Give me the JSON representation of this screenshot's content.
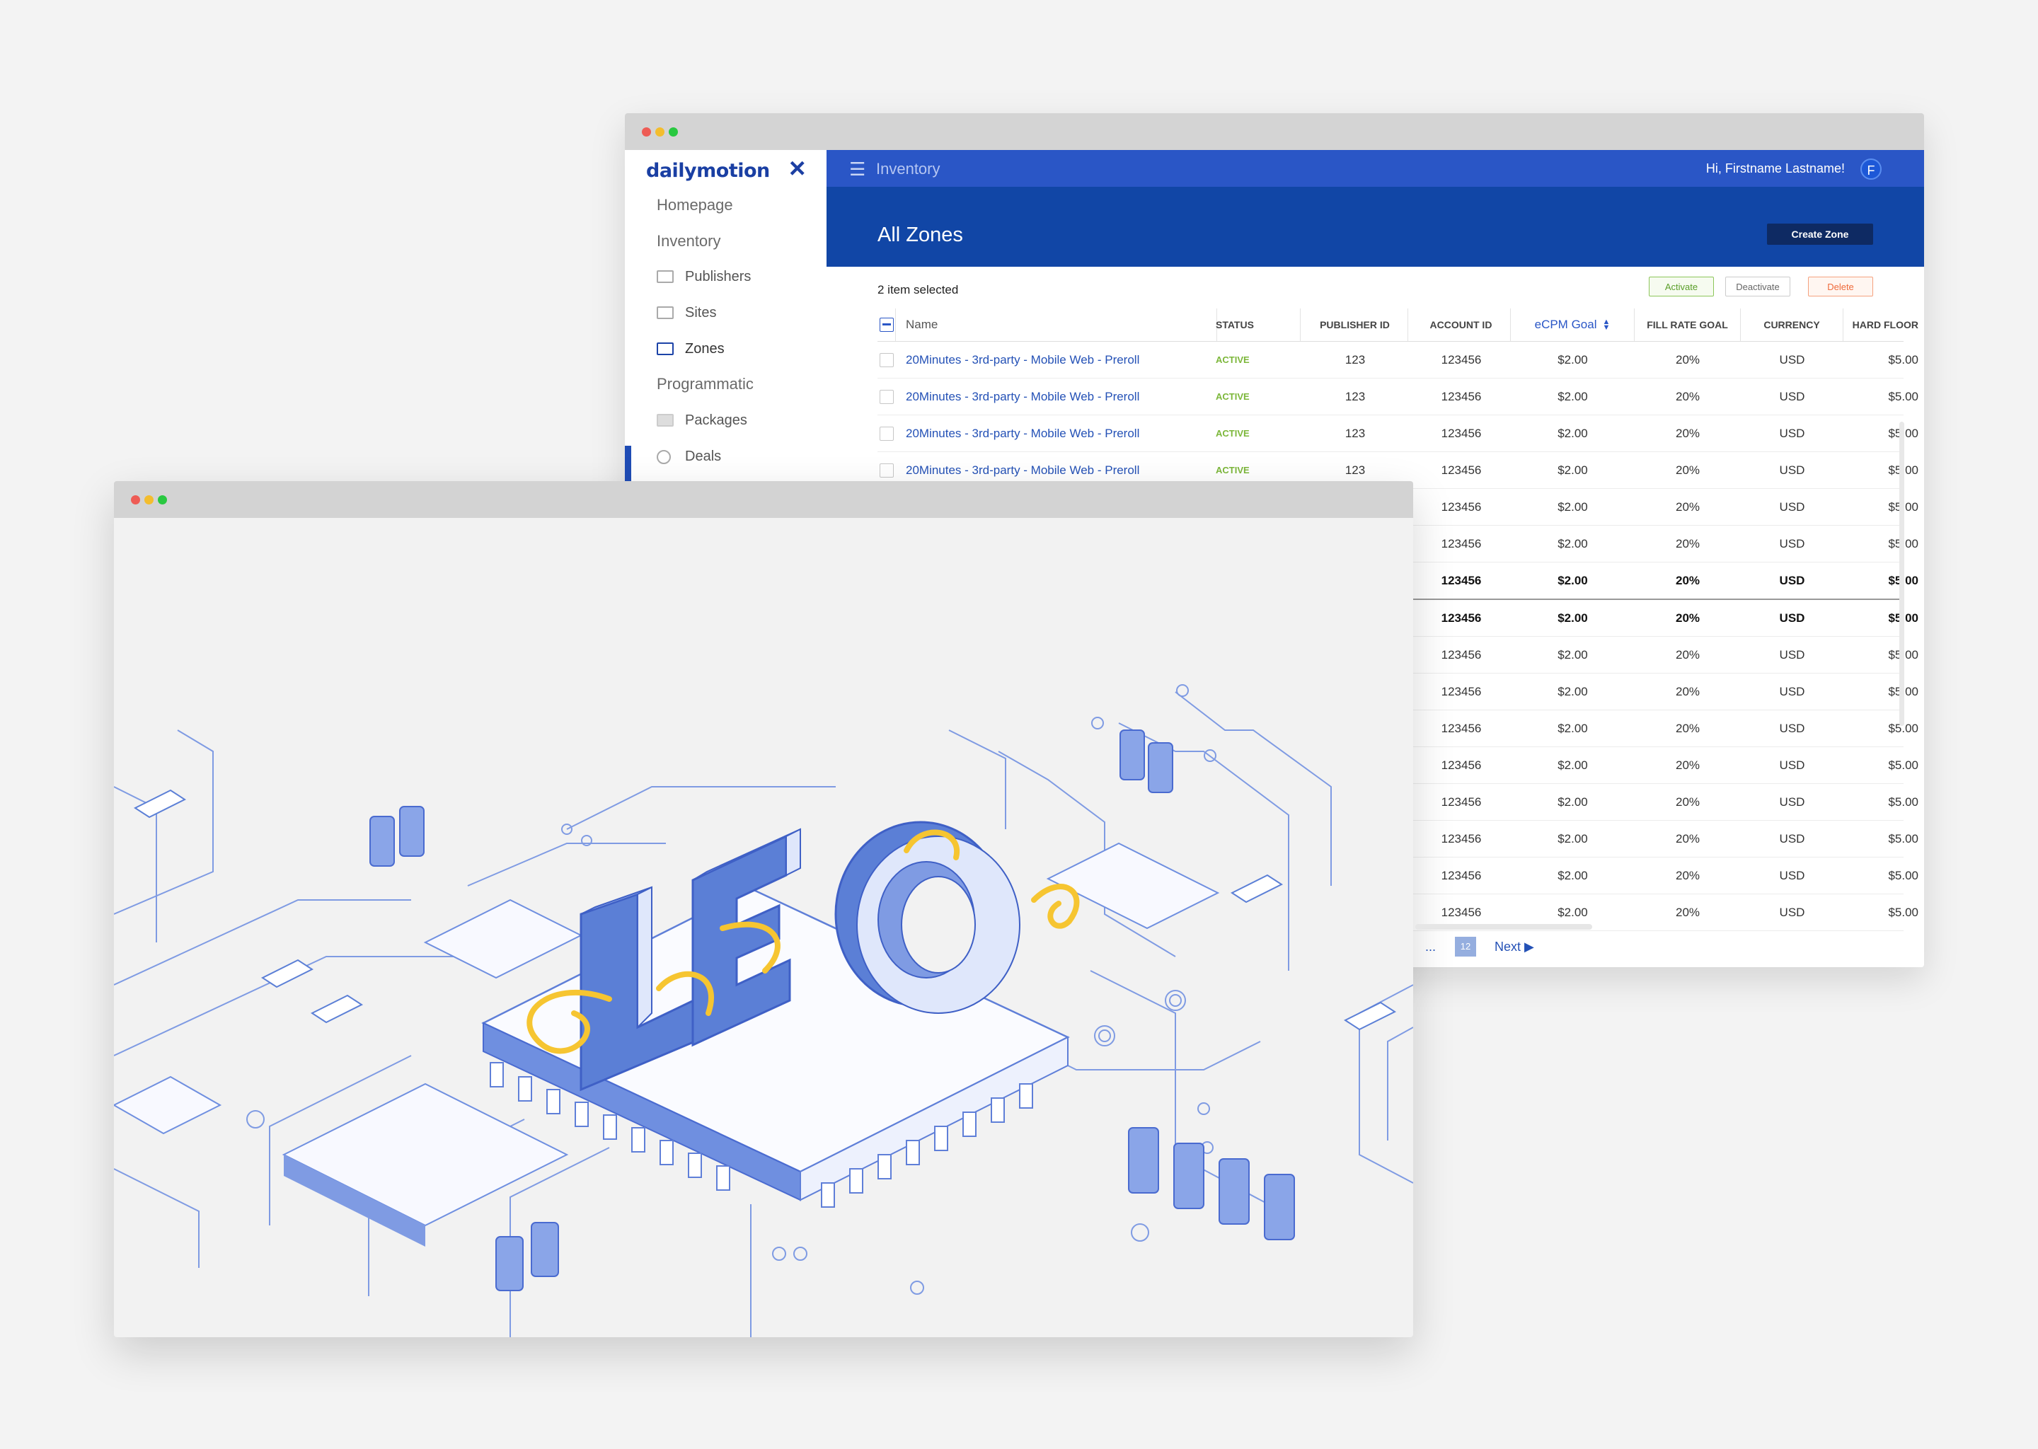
{
  "back_window": {
    "sidebar": {
      "logo": "dailymotion",
      "sections": [
        {
          "label": "Homepage"
        },
        {
          "label": "Inventory"
        },
        {
          "label": "Programmatic"
        }
      ],
      "items": [
        {
          "label": "Publishers",
          "icon": "grid-icon"
        },
        {
          "label": "Sites",
          "icon": "window-icon"
        },
        {
          "label": "Zones",
          "icon": "zones-icon",
          "active": true
        },
        {
          "label": "Packages",
          "icon": "box-icon"
        },
        {
          "label": "Deals",
          "icon": "link-icon"
        }
      ]
    },
    "topbar": {
      "breadcrumb": "Inventory",
      "greeting": "Hi, Firstname Lastname!",
      "avatar_initial": "F"
    },
    "header": {
      "title": "All Zones",
      "create_label": "Create Zone"
    },
    "selection": {
      "count_label": "2 item selected",
      "activate_label": "Activate",
      "deactivate_label": "Deactivate",
      "delete_label": "Delete"
    },
    "table": {
      "columns": {
        "name": "Name",
        "status": "STATUS",
        "publisher_id": "PUBLISHER ID",
        "account_id": "ACCOUNT ID",
        "ecpm": "eCPM Goal",
        "fill": "FILL RATE GOAL",
        "currency": "CURRENCY",
        "floor": "HARD FLOOR"
      },
      "rows": [
        {
          "name": "20Minutes - 3rd-party - Mobile Web - Preroll",
          "status": "ACTIVE",
          "publisher_id": "123",
          "account_id": "123456",
          "ecpm": "$2.00",
          "fill": "20%",
          "currency": "USD",
          "floor": "$5.00"
        },
        {
          "name": "20Minutes - 3rd-party - Mobile Web - Preroll",
          "status": "ACTIVE",
          "publisher_id": "123",
          "account_id": "123456",
          "ecpm": "$2.00",
          "fill": "20%",
          "currency": "USD",
          "floor": "$5.00"
        },
        {
          "name": "20Minutes - 3rd-party - Mobile Web - Preroll",
          "status": "ACTIVE",
          "publisher_id": "123",
          "account_id": "123456",
          "ecpm": "$2.00",
          "fill": "20%",
          "currency": "USD",
          "floor": "$5.00"
        },
        {
          "name": "20Minutes - 3rd-party - Mobile Web - Preroll",
          "status": "ACTIVE",
          "publisher_id": "123",
          "account_id": "123456",
          "ecpm": "$2.00",
          "fill": "20%",
          "currency": "USD",
          "floor": "$5.00"
        },
        {
          "name": "",
          "status": "",
          "publisher_id": "",
          "account_id": "123456",
          "ecpm": "$2.00",
          "fill": "20%",
          "currency": "USD",
          "floor": "$5.00"
        },
        {
          "name": "",
          "status": "",
          "publisher_id": "",
          "account_id": "123456",
          "ecpm": "$2.00",
          "fill": "20%",
          "currency": "USD",
          "floor": "$5.00"
        },
        {
          "name": "",
          "status": "",
          "publisher_id": "",
          "account_id": "123456",
          "ecpm": "$2.00",
          "fill": "20%",
          "currency": "USD",
          "floor": "$5.00",
          "bold": true
        },
        {
          "name": "",
          "status": "",
          "publisher_id": "",
          "account_id": "123456",
          "ecpm": "$2.00",
          "fill": "20%",
          "currency": "USD",
          "floor": "$5.00",
          "bold": true
        },
        {
          "name": "",
          "status": "",
          "publisher_id": "",
          "account_id": "123456",
          "ecpm": "$2.00",
          "fill": "20%",
          "currency": "USD",
          "floor": "$5.00"
        },
        {
          "name": "",
          "status": "",
          "publisher_id": "",
          "account_id": "123456",
          "ecpm": "$2.00",
          "fill": "20%",
          "currency": "USD",
          "floor": "$5.00"
        },
        {
          "name": "",
          "status": "",
          "publisher_id": "",
          "account_id": "123456",
          "ecpm": "$2.00",
          "fill": "20%",
          "currency": "USD",
          "floor": "$5.00"
        },
        {
          "name": "",
          "status": "",
          "publisher_id": "",
          "account_id": "123456",
          "ecpm": "$2.00",
          "fill": "20%",
          "currency": "USD",
          "floor": "$5.00"
        },
        {
          "name": "",
          "status": "",
          "publisher_id": "",
          "account_id": "123456",
          "ecpm": "$2.00",
          "fill": "20%",
          "currency": "USD",
          "floor": "$5.00"
        },
        {
          "name": "",
          "status": "",
          "publisher_id": "",
          "account_id": "123456",
          "ecpm": "$2.00",
          "fill": "20%",
          "currency": "USD",
          "floor": "$5.00"
        },
        {
          "name": "",
          "status": "",
          "publisher_id": "",
          "account_id": "123456",
          "ecpm": "$2.00",
          "fill": "20%",
          "currency": "USD",
          "floor": "$5.00"
        },
        {
          "name": "",
          "status": "",
          "publisher_id": "",
          "account_id": "123456",
          "ecpm": "$2.00",
          "fill": "20%",
          "currency": "USD",
          "floor": "$5.00"
        }
      ]
    },
    "pagination": {
      "ellipsis": "...",
      "page": "12",
      "next_label": "Next"
    }
  },
  "front_window": {
    "illustration_text": "LEO",
    "colors": {
      "primary_blue": "#5b7fd6",
      "light_blue": "#8aa5e8",
      "line_blue": "#6f8fe0",
      "yellow": "#f6c531"
    }
  },
  "colors": {
    "brand_blue": "#1a3fa3",
    "topbar": "#2a56c6",
    "header_band": "#1146a6",
    "active_green": "#7cb73a",
    "delete_orange": "#ef6b3c"
  }
}
